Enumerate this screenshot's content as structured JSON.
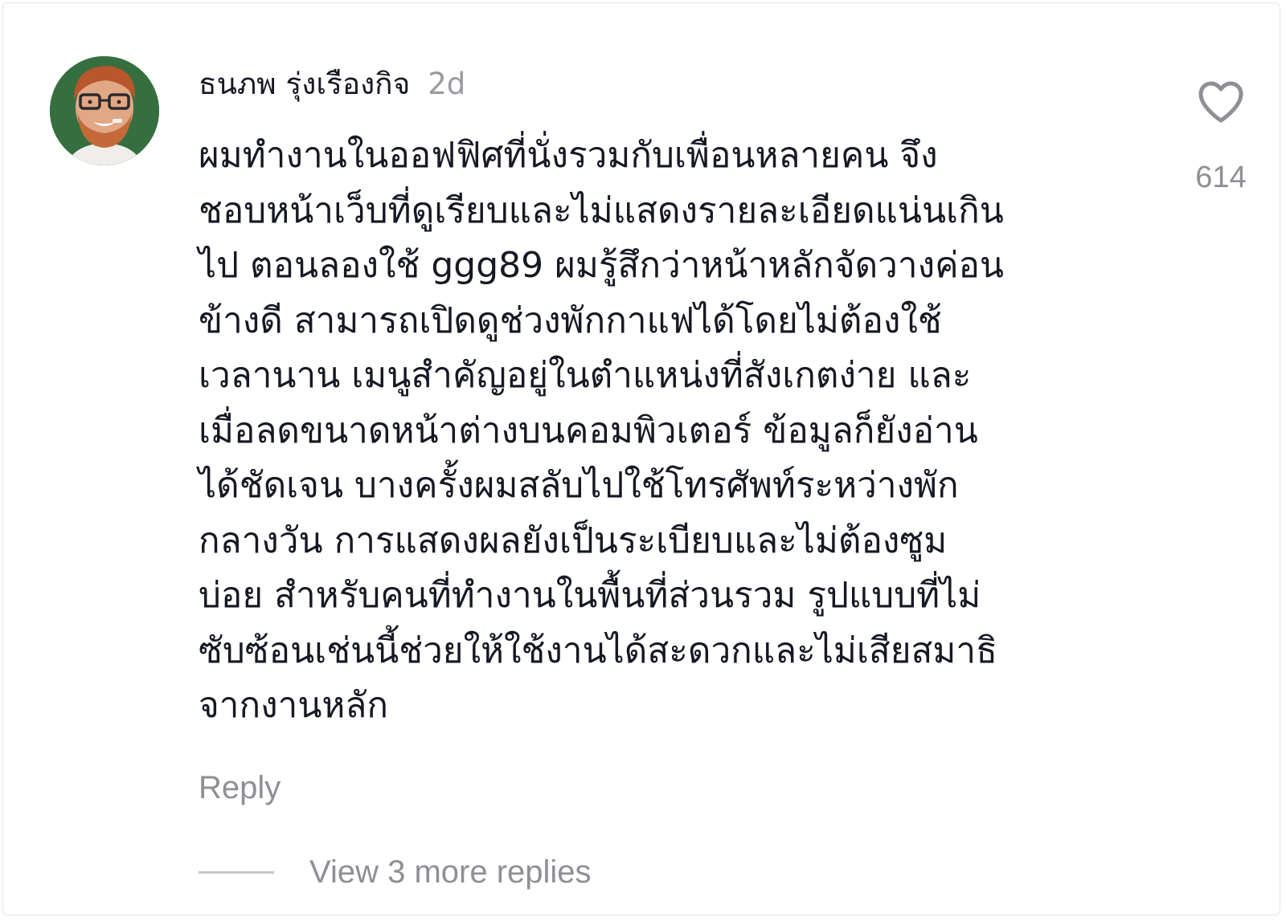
{
  "comment": {
    "username": "ธนภพ รุ่งเรืองกิจ",
    "time": "2d",
    "lines": [
      "ผมทำงานในออฟฟิศที่นั่งรวมกับเพื่อนหลายคน จึง",
      "ชอบหน้าเว็บที่ดูเรียบและไม่แสดงรายละเอียดแน่นเกิน",
      "ไป ตอนลองใช้ ggg89 ผมรู้สึกว่าหน้าหลักจัดวางค่อน",
      "ข้างดี สามารถเปิดดูช่วงพักกาแฟได้โดยไม่ต้องใช้",
      "เวลานาน เมนูสำคัญอยู่ในตำแหน่งที่สังเกตง่าย และ",
      "เมื่อลดขนาดหน้าต่างบนคอมพิวเตอร์ ข้อมูลก็ยังอ่าน",
      "ได้ชัดเจน บางครั้งผมสลับไปใช้โทรศัพท์ระหว่างพัก",
      "กลางวัน การแสดงผลยังเป็นระเบียบและไม่ต้องซูม",
      "บ่อย สำหรับคนที่ทำงานในพื้นที่ส่วนรวม รูปแบบที่ไม่",
      "ซับซ้อนเช่นนี้ช่วยให้ใช้งานได้สะดวกและไม่เสียสมาธิ",
      "จากงานหลัก"
    ],
    "like_count": "614",
    "like_icon": "heart-outline-icon",
    "reply_label": "Reply",
    "view_more_label": "View 3 more replies"
  },
  "colors": {
    "text": "#161823",
    "muted": "#8f8f95",
    "avatar_bg": "#2e6b3a",
    "divider": "#c7c7c9"
  }
}
